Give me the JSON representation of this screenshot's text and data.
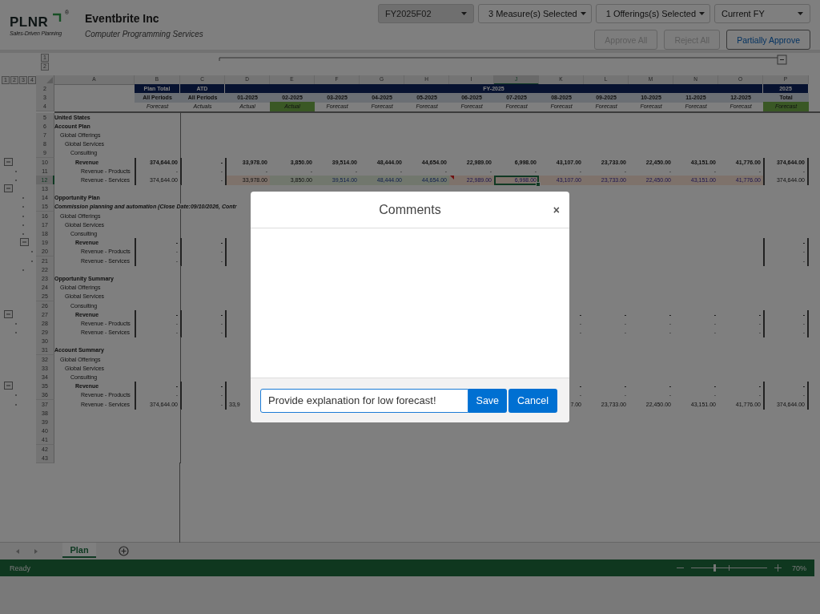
{
  "logo": {
    "mark": "PLNR",
    "registered": "®",
    "tagline": "Sales-Driven Planning"
  },
  "company": {
    "name": "Eventbrite Inc",
    "industry": "Computer Programming Services"
  },
  "filters": [
    {
      "value": "FY2025F02",
      "kind": "select",
      "disabled": true
    },
    {
      "value": "3 Measure(s) Selected",
      "kind": "menu",
      "disabled": false
    },
    {
      "value": "1 Offerings(s) Selected",
      "kind": "menu",
      "disabled": false
    },
    {
      "value": "Current FY",
      "kind": "select",
      "disabled": false
    }
  ],
  "actions": [
    {
      "label": "Approve All",
      "disabled": true
    },
    {
      "label": "Reject All",
      "disabled": true
    },
    {
      "label": "Partially Approve",
      "disabled": false
    }
  ],
  "outline_levels": [
    "1",
    "2",
    "3",
    "4"
  ],
  "row_outline_levels": [
    "1",
    "2"
  ],
  "columns": [
    {
      "label": "A",
      "selected": false
    },
    {
      "label": "B",
      "selected": false
    },
    {
      "label": "C",
      "selected": false
    },
    {
      "label": "D",
      "selected": false
    },
    {
      "label": "E",
      "selected": false
    },
    {
      "label": "F",
      "selected": false
    },
    {
      "label": "G",
      "selected": false
    },
    {
      "label": "H",
      "selected": false
    },
    {
      "label": "I",
      "selected": false
    },
    {
      "label": "J",
      "selected": true
    },
    {
      "label": "K",
      "selected": false
    },
    {
      "label": "L",
      "selected": false
    },
    {
      "label": "M",
      "selected": false
    },
    {
      "label": "N",
      "selected": false
    },
    {
      "label": "O",
      "selected": false
    },
    {
      "label": "P",
      "selected": false
    }
  ],
  "header_rows": {
    "top": {
      "num": "2",
      "plan": "Plan Total",
      "atd": "ATD",
      "period": "FY-2025",
      "year": "2025"
    },
    "periods": {
      "num": "3",
      "cells": [
        "All Periods",
        "All Periods",
        "01-2025",
        "02-2025",
        "03-2025",
        "04-2025",
        "05-2025",
        "06-2025",
        "07-2025",
        "08-2025",
        "09-2025",
        "10-2025",
        "11-2025",
        "12-2025",
        "Total"
      ]
    },
    "types": {
      "num": "4",
      "cells": [
        {
          "text": "Forecast",
          "highlight": false
        },
        {
          "text": "Actuals",
          "highlight": false
        },
        {
          "text": "Actual",
          "highlight": false
        },
        {
          "text": "Actual",
          "highlight": true
        },
        {
          "text": "Forecast",
          "highlight": false
        },
        {
          "text": "Forecast",
          "highlight": false
        },
        {
          "text": "Forecast",
          "highlight": false
        },
        {
          "text": "Forecast",
          "highlight": false
        },
        {
          "text": "Forecast",
          "highlight": false
        },
        {
          "text": "Forecast",
          "highlight": false
        },
        {
          "text": "Forecast",
          "highlight": false
        },
        {
          "text": "Forecast",
          "highlight": false
        },
        {
          "text": "Forecast",
          "highlight": false
        },
        {
          "text": "Forecast",
          "highlight": false
        },
        {
          "text": "Forecast",
          "highlight": true
        }
      ]
    }
  },
  "rows": [
    {
      "num": "5",
      "kind": "heading",
      "label": "United States",
      "selected": false
    },
    {
      "num": "6",
      "kind": "heading",
      "label": "Account Plan",
      "selected": false
    },
    {
      "num": "7",
      "kind": "offerings",
      "label": "Global Offerings",
      "selected": false
    },
    {
      "num": "8",
      "kind": "services",
      "label": "Global Services",
      "selected": false
    },
    {
      "num": "9",
      "kind": "category",
      "label": "Consulting",
      "selected": false
    },
    {
      "num": "10",
      "kind": "revenue",
      "label": "Revenue",
      "selected": false,
      "outline": {
        "kind": "outer-toggle"
      },
      "cells": {
        "b": "374,644.00",
        "c": "-",
        "d": "33,978.00",
        "e": "3,850.00",
        "f": "39,514.00",
        "g": "48,444.00",
        "h": "44,654.00",
        "i": "22,989.00",
        "j": "6,998.00",
        "k": "43,107.00",
        "l": "23,733.00",
        "m": "22,450.00",
        "n": "43,151.00",
        "o": "41,776.00",
        "p": "374,644.00"
      }
    },
    {
      "num": "11",
      "kind": "line",
      "label": "Revenue - Products",
      "selected": false,
      "outline": {
        "kind": "outer-dot"
      },
      "cells": {
        "b": "-",
        "c": "-",
        "d": "-",
        "e": "-",
        "f": "-",
        "g": "-",
        "h": "-",
        "i": "-",
        "j": "-",
        "k": "-",
        "l": "-",
        "m": "-",
        "n": "-",
        "o": "-",
        "p": "-"
      }
    },
    {
      "num": "12",
      "kind": "line",
      "label": "Revenue - Services",
      "selected": true,
      "outline": {
        "kind": "outer-dot"
      },
      "cells": {
        "b": "374,644.00",
        "c": "-",
        "d": {
          "text": "33,978.00",
          "kind": "actual",
          "selected": false,
          "comment": false
        },
        "e": {
          "text": "3,850.00",
          "kind": "approved",
          "selected": false,
          "comment": false
        },
        "f": {
          "text": "39,514.00",
          "kind": "adjusted",
          "selected": false,
          "comment": false
        },
        "g": {
          "text": "48,444.00",
          "kind": "adjusted",
          "selected": false,
          "comment": false
        },
        "h": {
          "text": "44,654.00",
          "kind": "adjusted",
          "selected": false,
          "comment": false
        },
        "i": {
          "text": "22,989.00",
          "kind": "forecast",
          "selected": false,
          "comment": true
        },
        "j": {
          "text": "6,998.00",
          "kind": "forecast",
          "selected": true,
          "comment": false
        },
        "k": {
          "text": "43,107.00",
          "kind": "forecast",
          "selected": false,
          "comment": false
        },
        "l": {
          "text": "23,733.00",
          "kind": "forecast",
          "selected": false,
          "comment": false
        },
        "m": {
          "text": "22,450.00",
          "kind": "forecast",
          "selected": false,
          "comment": false
        },
        "n": {
          "text": "43,151.00",
          "kind": "forecast",
          "selected": false,
          "comment": false
        },
        "o": {
          "text": "41,776.00",
          "kind": "forecast",
          "selected": false,
          "comment": false
        },
        "p": "374,644.00"
      }
    },
    {
      "num": "13",
      "kind": "blank",
      "selected": false,
      "outline": {
        "kind": "outer-toggle"
      }
    },
    {
      "num": "14",
      "kind": "heading",
      "label": "Opportunity Plan",
      "selected": false,
      "outline": {
        "kind": "mid-dot"
      }
    },
    {
      "num": "15",
      "kind": "deal",
      "label": "Commission planning and automation (Close Date:09/10/2026, Contr",
      "selected": false,
      "outline": {
        "kind": "mid-dot"
      }
    },
    {
      "num": "16",
      "kind": "offerings",
      "label": "Global Offerings",
      "selected": false,
      "outline": {
        "kind": "mid-dot"
      }
    },
    {
      "num": "17",
      "kind": "services",
      "label": "Global Services",
      "selected": false,
      "outline": {
        "kind": "mid-dot"
      }
    },
    {
      "num": "18",
      "kind": "category",
      "label": "Consulting",
      "selected": false,
      "outline": {
        "kind": "mid-dot"
      }
    },
    {
      "num": "19",
      "kind": "revenue",
      "label": "Revenue",
      "selected": false,
      "outline": {
        "kind": "inner-toggle"
      },
      "cells": {
        "b": "-",
        "c": "-",
        "p": "-"
      }
    },
    {
      "num": "20",
      "kind": "line",
      "label": "Revenue - Products",
      "selected": false,
      "outline": {
        "kind": "inner-dot"
      },
      "cells": {
        "b": "-",
        "c": "-",
        "p": "-"
      }
    },
    {
      "num": "21",
      "kind": "line",
      "label": "Revenue - Services",
      "selected": false,
      "outline": {
        "kind": "inner-dot"
      },
      "cells": {
        "b": "-",
        "c": "-",
        "p": "-"
      }
    },
    {
      "num": "22",
      "kind": "blank",
      "selected": false,
      "outline": {
        "kind": "mid-dot"
      }
    },
    {
      "num": "23",
      "kind": "heading",
      "label": "Opportunity Summary",
      "selected": false
    },
    {
      "num": "24",
      "kind": "offerings",
      "label": "Global Offerings",
      "selected": false
    },
    {
      "num": "25",
      "kind": "services",
      "label": "Global Services",
      "selected": false
    },
    {
      "num": "26",
      "kind": "category",
      "label": "Consulting",
      "selected": false
    },
    {
      "num": "27",
      "kind": "revenue",
      "label": "Revenue",
      "selected": false,
      "outline": {
        "kind": "outer-toggle"
      },
      "cells": {
        "b": "-",
        "c": "-",
        "k": "-",
        "l": "-",
        "m": "-",
        "n": "-",
        "o": "-",
        "p": "-"
      }
    },
    {
      "num": "28",
      "kind": "line",
      "label": "Revenue - Products",
      "selected": false,
      "outline": {
        "kind": "outer-dot"
      },
      "cells": {
        "b": "-",
        "c": "-",
        "k": "-",
        "l": "-",
        "m": "-",
        "n": "-",
        "o": "-",
        "p": "-"
      }
    },
    {
      "num": "29",
      "kind": "line",
      "label": "Revenue - Services",
      "selected": false,
      "outline": {
        "kind": "outer-dot"
      },
      "cells": {
        "b": "-",
        "c": "-",
        "k": "-",
        "l": "-",
        "m": "-",
        "n": "-",
        "o": "-",
        "p": "-"
      }
    },
    {
      "num": "30",
      "kind": "blank",
      "selected": false
    },
    {
      "num": "31",
      "kind": "heading",
      "label": "Account Summary",
      "selected": false
    },
    {
      "num": "32",
      "kind": "offerings",
      "label": "Global Offerings",
      "selected": false
    },
    {
      "num": "33",
      "kind": "services",
      "label": "Global Services",
      "selected": false
    },
    {
      "num": "34",
      "kind": "category",
      "label": "Consulting",
      "selected": false
    },
    {
      "num": "35",
      "kind": "revenue",
      "label": "Revenue",
      "selected": false,
      "outline": {
        "kind": "outer-toggle"
      },
      "cells": {
        "b": "-",
        "c": "-",
        "k": "-",
        "l": "-",
        "m": "-",
        "n": "-",
        "o": "-",
        "p": "-"
      }
    },
    {
      "num": "36",
      "kind": "line",
      "label": "Revenue - Products",
      "selected": false,
      "outline": {
        "kind": "outer-dot"
      },
      "cells": {
        "b": "-",
        "c": "-",
        "k": "-",
        "l": "-",
        "m": "-",
        "n": "-",
        "o": "-",
        "p": "-"
      }
    },
    {
      "num": "37",
      "kind": "line",
      "label": "Revenue - Services",
      "selected": false,
      "outline": {
        "kind": "outer-dot"
      },
      "cells": {
        "b": "374,644.00",
        "c": "-",
        "d": {
          "text": "33,9",
          "cut": true
        },
        "k": "7.00",
        "l": "23,733.00",
        "m": "22,450.00",
        "n": "43,151.00",
        "o": "41,776.00",
        "p": "374,644.00"
      }
    },
    {
      "num": "38",
      "kind": "blank",
      "selected": false
    },
    {
      "num": "39",
      "kind": "blank",
      "selected": false
    },
    {
      "num": "40",
      "kind": "blank",
      "selected": false
    },
    {
      "num": "41",
      "kind": "blank",
      "selected": false
    },
    {
      "num": "42",
      "kind": "blank",
      "selected": false
    },
    {
      "num": "43",
      "kind": "blank",
      "selected": false
    }
  ],
  "sheet_tabs": [
    {
      "label": "Plan",
      "selected": true
    }
  ],
  "status_bar": {
    "status": "Ready",
    "zoom": "70%",
    "zoom_slider": {
      "level": 0.3
    }
  },
  "dialog": {
    "title": "Comments",
    "close": "×",
    "comment": {
      "value": "Provide explanation for low forecast!"
    },
    "buttons": [
      {
        "label": "Save"
      },
      {
        "label": "Cancel"
      }
    ]
  }
}
